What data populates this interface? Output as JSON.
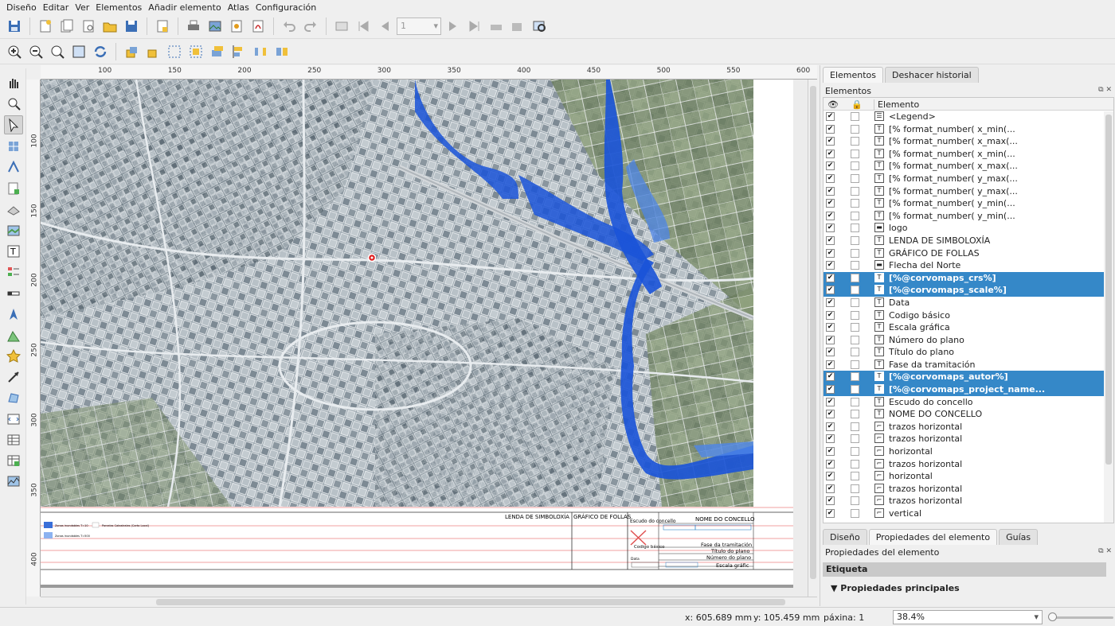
{
  "menu": [
    "Diseño",
    "Editar",
    "Ver",
    "Elementos",
    "Añadir elemento",
    "Atlas",
    "Configuración"
  ],
  "toolbar": {
    "page_number": "1"
  },
  "rulers": {
    "top": [
      "100",
      "150",
      "200",
      "250",
      "300",
      "350",
      "400",
      "450",
      "500",
      "550",
      "600"
    ],
    "left": [
      "100",
      "150",
      "200",
      "250",
      "300",
      "350",
      "400"
    ]
  },
  "layout_content": {
    "legend_title": "LENDA DE SIMBOLOXÍA",
    "sheets_title": "GRÁFICO DE FOLLAS",
    "shield": "Escudo do concello",
    "council_name": "NOME DO CONCELLO",
    "phase": "Fase da tramitación",
    "plan_title": "Título do plano",
    "plan_number": "Número do plano",
    "scale": "Escala gráfic",
    "basic_code": "Codigo básico",
    "date": "Data",
    "legend_items": [
      "Zonas inundables T=10",
      "Zonas inundables T=500",
      "Parcelas Catastrales (Carto Local)"
    ]
  },
  "status": {
    "x": "x: 605.689 mm",
    "y": "y: 105.459 mm",
    "page": "páxina: 1",
    "zoom": "38.4%"
  },
  "panel": {
    "top_tabs": [
      "Elementos",
      "Deshacer historial"
    ],
    "title": "Elementos",
    "col_element": "Elemento",
    "items": [
      {
        "label": "<Legend>",
        "icon": "legend-icon",
        "selected": false
      },
      {
        "label": "[% format_number( x_min(...",
        "icon": "label-icon",
        "selected": false
      },
      {
        "label": "[% format_number( x_max(...",
        "icon": "label-icon",
        "selected": false
      },
      {
        "label": "[% format_number( x_min(...",
        "icon": "label-icon",
        "selected": false
      },
      {
        "label": "[% format_number( x_max(...",
        "icon": "label-icon",
        "selected": false
      },
      {
        "label": "[% format_number( y_max(...",
        "icon": "label-icon",
        "selected": false
      },
      {
        "label": "[% format_number( y_max(...",
        "icon": "label-icon",
        "selected": false
      },
      {
        "label": "[% format_number( y_min(...",
        "icon": "label-icon",
        "selected": false
      },
      {
        "label": "[% format_number( y_min(...",
        "icon": "label-icon",
        "selected": false
      },
      {
        "label": "logo",
        "icon": "picture-icon",
        "selected": false
      },
      {
        "label": "LENDA DE SIMBOLOXÍA",
        "icon": "label-icon",
        "selected": false
      },
      {
        "label": "GRÁFICO DE FOLLAS",
        "icon": "label-icon",
        "selected": false
      },
      {
        "label": "Flecha del Norte",
        "icon": "picture-icon",
        "selected": false
      },
      {
        "label": "[%@corvomaps_crs%]",
        "icon": "label-icon",
        "selected": true
      },
      {
        "label": "[%@corvomaps_scale%]",
        "icon": "label-icon",
        "selected": true
      },
      {
        "label": "Data",
        "icon": "label-icon",
        "selected": false
      },
      {
        "label": "Codigo básico",
        "icon": "label-icon",
        "selected": false
      },
      {
        "label": "Escala gráfica",
        "icon": "label-icon",
        "selected": false
      },
      {
        "label": "Número do plano",
        "icon": "label-icon",
        "selected": false
      },
      {
        "label": "Título do plano",
        "icon": "label-icon",
        "selected": false
      },
      {
        "label": "Fase da tramitación",
        "icon": "label-icon",
        "selected": false
      },
      {
        "label": "[%@corvomaps_autor%]",
        "icon": "label-icon",
        "selected": true
      },
      {
        "label": "[%@corvomaps_project_name...",
        "icon": "label-icon",
        "selected": true
      },
      {
        "label": "Escudo do concello",
        "icon": "label-icon",
        "selected": false
      },
      {
        "label": "NOME DO CONCELLO",
        "icon": "label-icon",
        "selected": false
      },
      {
        "label": "trazos horizontal",
        "icon": "polyline-icon",
        "selected": false
      },
      {
        "label": "trazos horizontal",
        "icon": "polyline-icon",
        "selected": false
      },
      {
        "label": "horizontal",
        "icon": "polyline-icon",
        "selected": false
      },
      {
        "label": "trazos horizontal",
        "icon": "polyline-icon",
        "selected": false
      },
      {
        "label": "horizontal",
        "icon": "polyline-icon",
        "selected": false
      },
      {
        "label": "trazos horizontal",
        "icon": "polyline-icon",
        "selected": false
      },
      {
        "label": "trazos horizontal",
        "icon": "polyline-icon",
        "selected": false
      },
      {
        "label": "vertical",
        "icon": "polyline-icon",
        "selected": false
      }
    ],
    "bottom_tabs": [
      "Diseño",
      "Propiedades del elemento",
      "Guías"
    ],
    "props_title": "Propiedades del elemento",
    "props_section": "Etiqueta",
    "props_group": "Propiedades principales"
  },
  "colors": {
    "selection": "#3588c8",
    "flood": "#1a53d8",
    "flood_light": "#4e86e8"
  }
}
